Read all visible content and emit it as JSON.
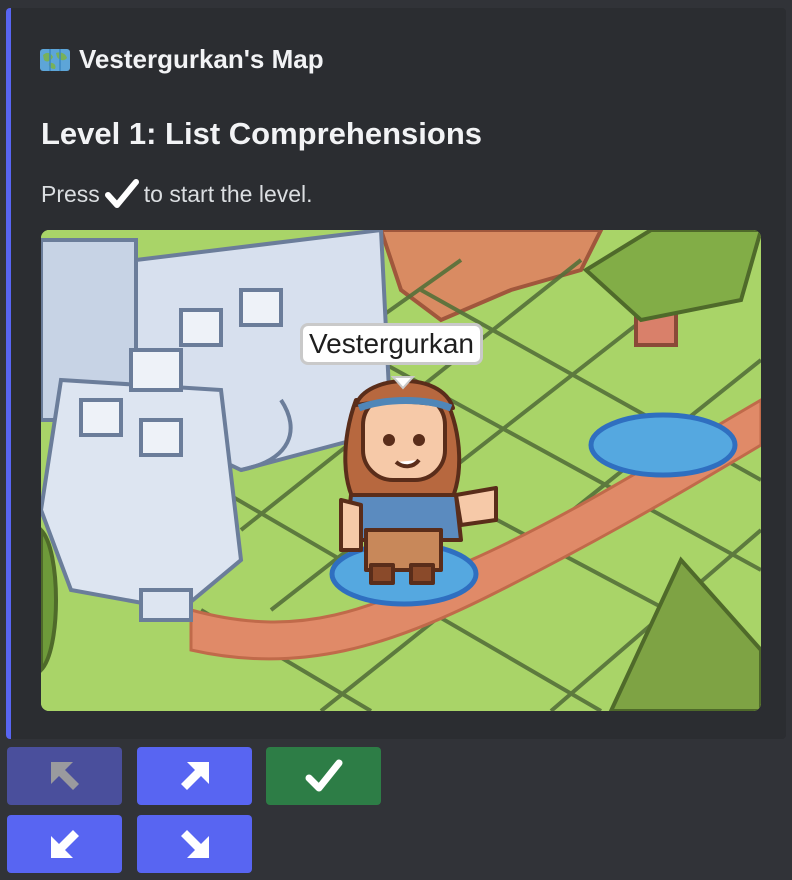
{
  "embed": {
    "author_icon": "world-map-icon",
    "author_name": "Vestergurkan's Map",
    "title": "Level 1: List Comprehensions",
    "description_before": "Press",
    "description_icon": "check-mark-icon",
    "description_after": "to start the level.",
    "accent_color": "#5865f2"
  },
  "scene": {
    "player_name": "Vestergurkan"
  },
  "buttons": [
    {
      "name": "move-up-left-button",
      "icon": "arrow-up-left-icon",
      "disabled": true,
      "color": "#4a4f9c"
    },
    {
      "name": "move-up-right-button",
      "icon": "arrow-up-right-icon",
      "disabled": false,
      "color": "#5865f2"
    },
    {
      "name": "start-level-button",
      "icon": "check-mark-icon",
      "disabled": false,
      "color": "#2d7d46"
    },
    {
      "name": "move-down-left-button",
      "icon": "arrow-down-left-icon",
      "disabled": false,
      "color": "#5865f2"
    },
    {
      "name": "move-down-right-button",
      "icon": "arrow-down-right-icon",
      "disabled": false,
      "color": "#5865f2"
    }
  ]
}
